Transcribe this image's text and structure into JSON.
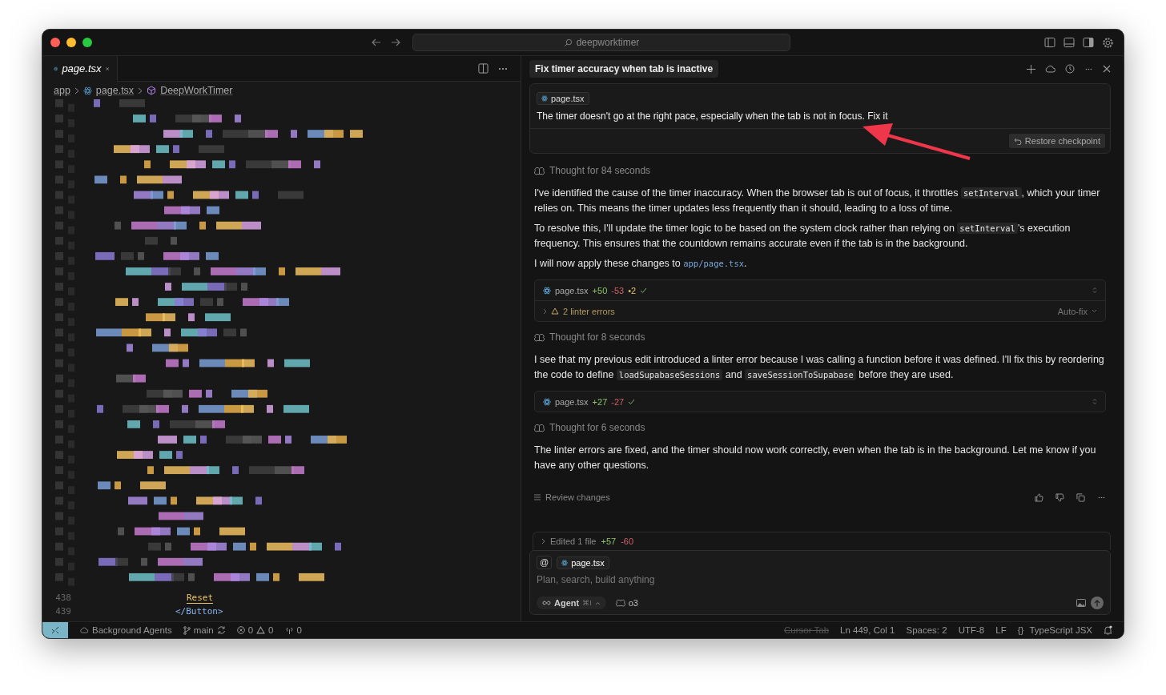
{
  "window": {
    "search": "deepworktimer"
  },
  "editor": {
    "tabs": [
      {
        "label": "page.tsx",
        "selected": true
      }
    ],
    "breadcrumb": [
      "app",
      "page.tsx",
      "DeepWorkTimer"
    ],
    "code_lines": [
      {
        "number": "438",
        "text": "Reset",
        "kind": "text"
      },
      {
        "number": "439",
        "text": "</Button>",
        "kind": "tag"
      }
    ]
  },
  "chat": {
    "title": "Fix timer accuracy when tab is inactive",
    "user_message": {
      "file": "page.tsx",
      "text": "The timer doesn't go at the right pace, especially when the tab is not in focus. Fix it",
      "restore": "Restore checkpoint"
    },
    "items": [
      {
        "kind": "thought",
        "text": "Thought for 84 seconds"
      },
      {
        "kind": "paragraph",
        "parts": [
          {
            "text": "I've identified the cause of the timer inaccuracy. When the browser tab is out of focus, it throttles "
          },
          {
            "text": "setInterval",
            "kind": "code"
          },
          {
            "text": ", which your timer relies on. This means the timer updates less frequently than it should, leading to a loss of time."
          }
        ]
      },
      {
        "kind": "paragraph",
        "parts": [
          {
            "text": "To resolve this, I'll update the timer logic to be based on the system clock rather than relying on "
          },
          {
            "text": "setInterval",
            "kind": "code"
          },
          {
            "text": "'s execution frequency. This ensures that the countdown remains accurate even if the tab is in the background."
          }
        ]
      },
      {
        "kind": "paragraph",
        "parts": [
          {
            "text": "I will now apply these changes to "
          },
          {
            "text": "app/page.tsx",
            "kind": "link"
          },
          {
            "text": "."
          }
        ]
      },
      {
        "kind": "file_edit",
        "file": "page.tsx",
        "added": "+50",
        "removed": "-53",
        "changed": "•2",
        "linter": "2 linter errors",
        "autofix": "Auto-fix"
      },
      {
        "kind": "thought",
        "text": "Thought for 8 seconds"
      },
      {
        "kind": "paragraph",
        "parts": [
          {
            "text": "I see that my previous edit introduced a linter error because I was calling a function before it was defined. I'll fix this by reordering the code to define "
          },
          {
            "text": "loadSupabaseSessions",
            "kind": "code"
          },
          {
            "text": " and "
          },
          {
            "text": "saveSessionToSupabase",
            "kind": "code"
          },
          {
            "text": " before they are used."
          }
        ]
      },
      {
        "kind": "file_edit",
        "file": "page.tsx",
        "added": "+27",
        "removed": "-27"
      },
      {
        "kind": "thought",
        "text": "Thought for 6 seconds"
      },
      {
        "kind": "paragraph",
        "parts": [
          {
            "text": "The linter errors are fixed, and the timer should now work correctly, even when the tab is in the background. Let me know if you have any other questions."
          }
        ]
      }
    ],
    "review": "Review changes",
    "edited": {
      "label": "Edited 1 file",
      "added": "+57",
      "removed": "-60"
    },
    "composer": {
      "mention": "@",
      "file": "page.tsx",
      "placeholder": "Plan, search, build anything",
      "mode": "Agent",
      "shortcut": "⌘I",
      "model": "o3"
    }
  },
  "status_bar": {
    "left": [
      {
        "kind": "agents",
        "text": "Background Agents"
      },
      {
        "kind": "branch",
        "text": "main"
      },
      {
        "kind": "problems",
        "errors": "0",
        "warnings": "0"
      },
      {
        "kind": "ports",
        "text": "0"
      }
    ],
    "right": [
      {
        "text": "Cursor Tab",
        "disabled": true
      },
      {
        "text": "Ln 449, Col 1",
        "disabled": false
      },
      {
        "text": "Spaces: 2",
        "disabled": false
      },
      {
        "text": "UTF-8",
        "disabled": false
      },
      {
        "text": "LF",
        "disabled": false
      },
      {
        "text": "TypeScript JSX",
        "disabled": false,
        "icon": "{}"
      }
    ]
  }
}
